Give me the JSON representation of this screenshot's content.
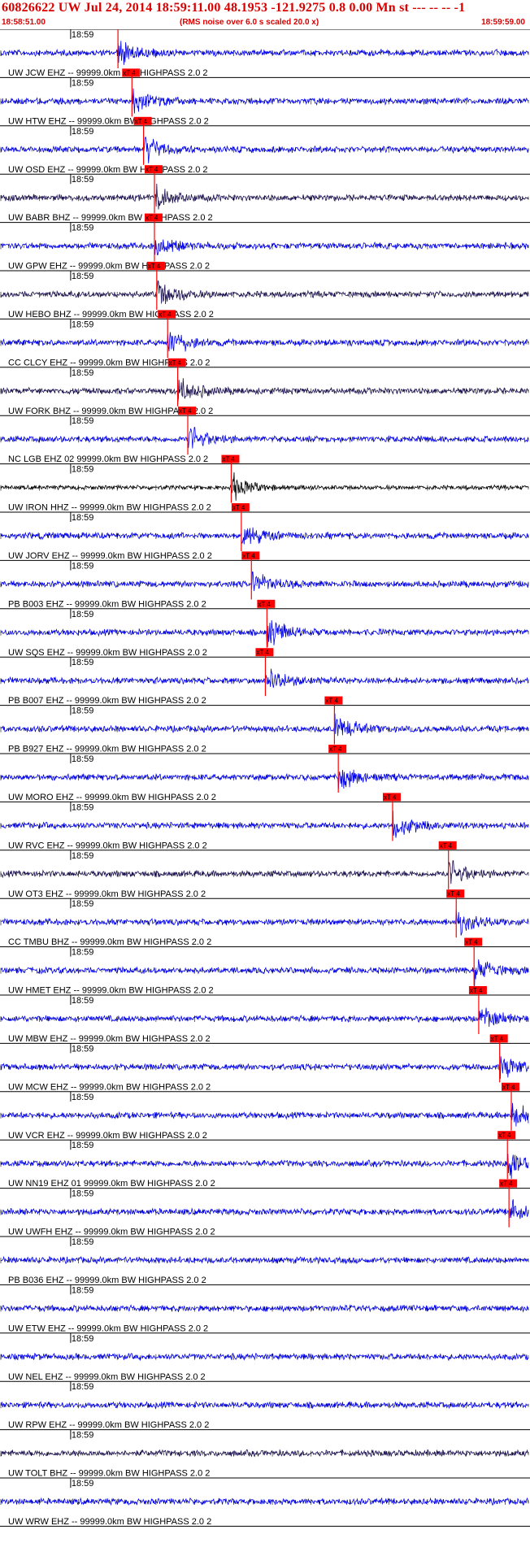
{
  "header": {
    "title": "60826622 UW Jul 24, 2014 18:59:11.00   48.1953 -121.9275  0.8 0.00 Mn st --- -- --   -1",
    "start_time": "18:58:51.00",
    "end_time": "18:59:59.00",
    "noise_note": "(RMS noise over 6.0 s scaled 20.0 x)"
  },
  "colors": {
    "background": "#ffffff",
    "header_text": "#d90000",
    "trace_blue": "#0000ee",
    "trace_dark": "#1a1050",
    "trace_black": "#000000",
    "pick_box": "#ff0000",
    "pick_line": "#ff0000",
    "grid": "#000000"
  },
  "chart_data": {
    "type": "seismogram-record-section",
    "time_window": {
      "start": "18:58:51.00",
      "end": "18:59:59.00",
      "duration_s": 68
    },
    "minute_label": "18:59",
    "pick_label": "xT 4",
    "traces": [
      {
        "station": "UW.JCW.EHZ.--",
        "label": "UW JCW EHZ -- 99999.0km BW  HIGHPASS  2.0  2",
        "pick_s": 15.1,
        "color": "blue"
      },
      {
        "station": "UW.HTW.EHZ.--",
        "label": "UW HTW EHZ -- 99999.0km BW  HIGHPASS  2.0  2",
        "pick_s": 16.9,
        "color": "blue"
      },
      {
        "station": "UW.OSD.EHZ.--",
        "label": "UW OSD EHZ -- 99999.0km BW  HIGHPASS  2.0  2",
        "pick_s": 18.4,
        "color": "blue"
      },
      {
        "station": "UW.BABR.BHZ.--",
        "label": "UW BABR BHZ -- 99999.0km BW  HIGHPASS  2.0  2",
        "pick_s": 19.8,
        "color": "dark"
      },
      {
        "station": "UW.GPW.EHZ.--",
        "label": "UW GPW EHZ -- 99999.0km BW  HIGHPASS  2.0  2",
        "pick_s": 19.8,
        "color": "blue"
      },
      {
        "station": "UW.HEBO.BHZ.--",
        "label": "UW HEBO BHZ -- 99999.0km BW  HIGHPASS  2.0  2",
        "pick_s": 20.1,
        "color": "dark"
      },
      {
        "station": "CC.CLCY.EHZ.--",
        "label": "CC CLCY EHZ -- 99999.0km BW  HIGHPASS  2.0  2",
        "pick_s": 21.5,
        "color": "blue"
      },
      {
        "station": "UW.FORK.BHZ.--",
        "label": "UW FORK BHZ -- 99999.0km BW  HIGHPASS  2.0  2",
        "pick_s": 22.8,
        "color": "dark"
      },
      {
        "station": "NC.LGB.EHZ.02",
        "label": "NC LGB EHZ 02 99999.0km BW  HIGHPASS  2.0  2",
        "pick_s": 24.1,
        "color": "blue"
      },
      {
        "station": "UW.IRON.HHZ.--",
        "label": "UW IRON HHZ -- 99999.0km BW  HIGHPASS  2.0  2",
        "pick_s": 29.7,
        "color": "black"
      },
      {
        "station": "UW.JORV.EHZ.--",
        "label": "UW JORV EHZ -- 99999.0km BW  HIGHPASS  2.0  2",
        "pick_s": 31.0,
        "color": "blue"
      },
      {
        "station": "PB.B003.EHZ.--",
        "label": "PB B003 EHZ -- 99999.0km BW  HIGHPASS  2.0  2",
        "pick_s": 32.3,
        "color": "blue"
      },
      {
        "station": "UW.SQS.EHZ.--",
        "label": "UW SQS EHZ -- 99999.0km BW  HIGHPASS  2.0  2",
        "pick_s": 34.3,
        "color": "blue"
      },
      {
        "station": "PB.B007.EHZ.--",
        "label": "PB B007 EHZ -- 99999.0km BW  HIGHPASS  2.0  2",
        "pick_s": 34.1,
        "color": "blue"
      },
      {
        "station": "PB.B927.EHZ.--",
        "label": "PB B927 EHZ -- 99999.0km BW  HIGHPASS  2.0  2",
        "pick_s": 43.0,
        "color": "blue"
      },
      {
        "station": "UW.MORO.EHZ.--",
        "label": "UW MORO EHZ -- 99999.0km BW  HIGHPASS  2.0  2",
        "pick_s": 43.5,
        "color": "blue"
      },
      {
        "station": "UW.RVC.EHZ.--",
        "label": "UW RVC EHZ -- 99999.0km BW  HIGHPASS  2.0  2",
        "pick_s": 50.5,
        "color": "blue"
      },
      {
        "station": "UW.OT3.EHZ.--",
        "label": "UW OT3 EHZ -- 99999.0km BW  HIGHPASS  2.0  2",
        "pick_s": 57.7,
        "color": "dark"
      },
      {
        "station": "CC.TMBU.BHZ.--",
        "label": "CC TMBU BHZ -- 99999.0km BW  HIGHPASS  2.0  2",
        "pick_s": 58.7,
        "color": "blue"
      },
      {
        "station": "UW.HMET.EHZ.--",
        "label": "UW HMET EHZ -- 99999.0km BW  HIGHPASS  2.0  2",
        "pick_s": 61.0,
        "color": "blue"
      },
      {
        "station": "UW.MBW.EHZ.--",
        "label": "UW MBW EHZ -- 99999.0km BW  HIGHPASS  2.0  2",
        "pick_s": 61.6,
        "color": "blue"
      },
      {
        "station": "UW.MCW.EHZ.--",
        "label": "UW MCW EHZ -- 99999.0km BW  HIGHPASS  2.0  2",
        "pick_s": 64.3,
        "color": "blue"
      },
      {
        "station": "UW.VCR.EHZ.--",
        "label": "UW VCR EHZ -- 99999.0km BW  HIGHPASS  2.0  2",
        "pick_s": 65.8,
        "color": "blue"
      },
      {
        "station": "UW.NN19.EHZ.01",
        "label": "UW NN19 EHZ 01 99999.0km BW  HIGHPASS  2.0  2",
        "pick_s": 65.3,
        "color": "blue"
      },
      {
        "station": "UW.UWFH.EHZ.--",
        "label": "UW UWFH EHZ -- 99999.0km BW  HIGHPASS  2.0  2",
        "pick_s": 65.5,
        "color": "blue"
      },
      {
        "station": "PB.B036.EHZ.--",
        "label": "PB B036 EHZ -- 99999.0km BW  HIGHPASS  2.0  2",
        "pick_s": null,
        "color": "blue"
      },
      {
        "station": "UW.ETW.EHZ.--",
        "label": "UW ETW EHZ -- 99999.0km BW  HIGHPASS  2.0  2",
        "pick_s": null,
        "color": "blue"
      },
      {
        "station": "UW.NEL.EHZ.--",
        "label": "UW NEL EHZ -- 99999.0km BW  HIGHPASS  2.0  2",
        "pick_s": null,
        "color": "blue"
      },
      {
        "station": "UW.RPW.EHZ.--",
        "label": "UW RPW EHZ -- 99999.0km BW  HIGHPASS  2.0  2",
        "pick_s": null,
        "color": "blue"
      },
      {
        "station": "UW.TOLT.BHZ.--",
        "label": "UW TOLT BHZ -- 99999.0km BW  HIGHPASS  2.0  2",
        "pick_s": null,
        "color": "dark"
      },
      {
        "station": "UW.WRW.EHZ.--",
        "label": "UW WRW EHZ -- 99999.0km BW  HIGHPASS  2.0  2",
        "pick_s": null,
        "color": "blue"
      }
    ]
  }
}
